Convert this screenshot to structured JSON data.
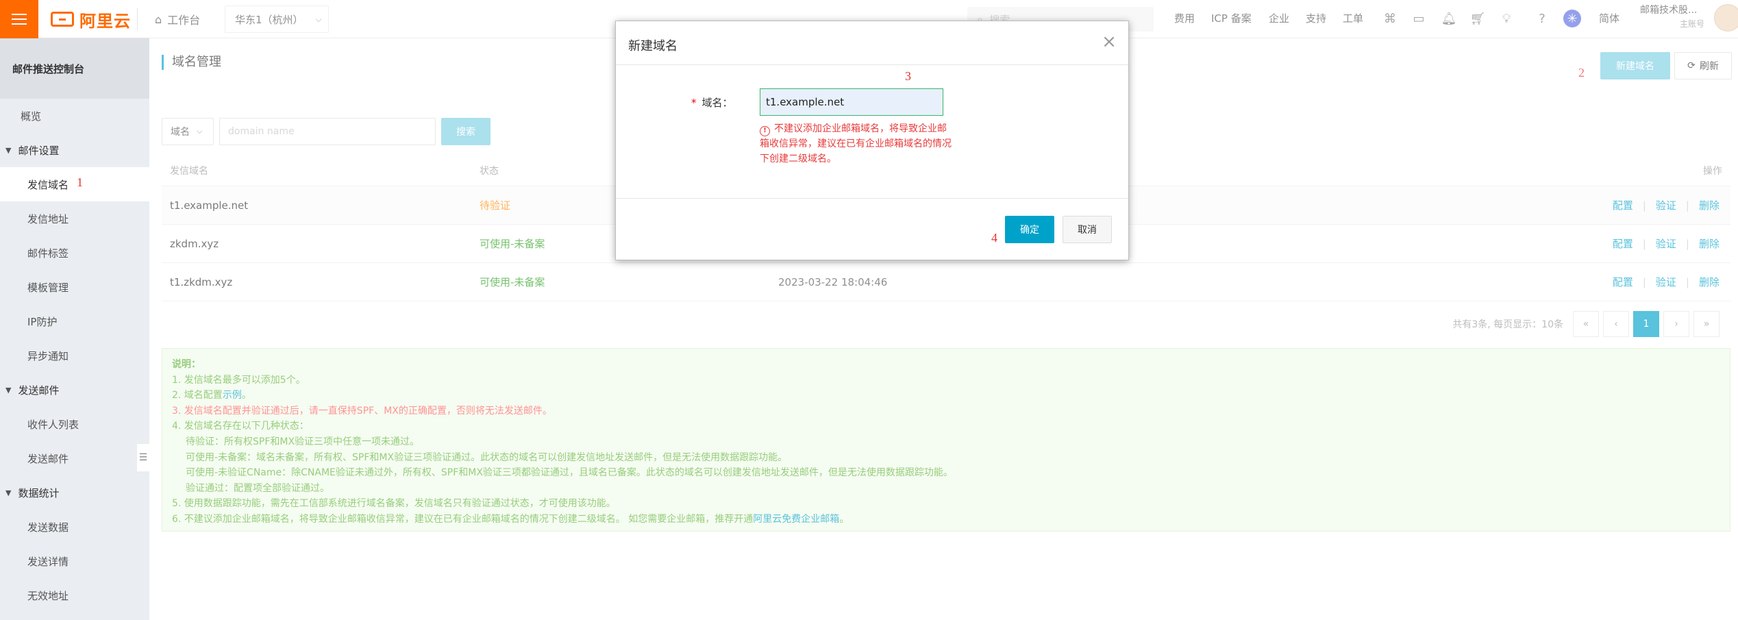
{
  "topbar": {
    "logo_text": "阿里云",
    "workbench": "工作台",
    "region": "华东1（杭州）",
    "search_placeholder": "搜索...",
    "nav": [
      "费用",
      "ICP 备案",
      "企业",
      "支持",
      "工单"
    ],
    "lang": "简体",
    "account_name": "邮箱技术股...",
    "account_role": "主账号"
  },
  "sidebar": {
    "title": "邮件推送控制台",
    "overview": "概览",
    "groups": [
      {
        "label": "邮件设置",
        "items": [
          "发信域名",
          "发信地址",
          "邮件标签",
          "模板管理",
          "IP防护",
          "异步通知"
        ]
      },
      {
        "label": "发送邮件",
        "items": [
          "收件人列表",
          "发送邮件"
        ]
      },
      {
        "label": "数据统计",
        "items": [
          "发送数据",
          "发送详情",
          "无效地址"
        ]
      }
    ]
  },
  "main": {
    "page_title": "域名管理",
    "new_domain_btn": "新建域名",
    "refresh_btn": "刷新",
    "filter_select": "域名",
    "filter_placeholder": "domain name",
    "search_btn": "搜索",
    "table": {
      "headers": {
        "domain": "发信域名",
        "status": "状态",
        "actions": "操作"
      },
      "rows": [
        {
          "domain": "t1.example.net",
          "status": "待验证",
          "time": ""
        },
        {
          "domain": "zkdm.xyz",
          "status": "可使用-未备案",
          "time": ""
        },
        {
          "domain": "t1.zkdm.xyz",
          "status": "可使用-未备案",
          "time": "2023-03-22 18:04:46"
        }
      ],
      "action_labels": [
        "配置",
        "验证",
        "删除"
      ]
    },
    "pagination": {
      "summary": "共有3条, 每页显示：10条",
      "first": "«",
      "prev": "‹",
      "current": "1",
      "next": "›",
      "last": "»"
    },
    "notes": {
      "title": "说明：",
      "l1": "1. 发信域名最多可以添加5个。",
      "l2_pre": "2. 域名配置",
      "l2_link": "示例",
      "l2_post": "。",
      "l3": "3. 发信域名配置并验证通过后，请一直保持SPF、MX的正确配置，否则将无法发送邮件。",
      "l4": "4. 发信域名存在以下几种状态：",
      "l4a": "待验证：所有权SPF和MX验证三项中任意一项未通过。",
      "l4b": "可使用-未备案：域名未备案，所有权、SPF和MX验证三项验证通过。此状态的域名可以创建发信地址发送邮件，但是无法使用数据跟踪功能。",
      "l4c": "可使用-未验证CName：除CNAME验证未通过外，所有权、SPF和MX验证三项都验证通过，且域名已备案。此状态的域名可以创建发信地址发送邮件，但是无法使用数据跟踪功能。",
      "l4d": "验证通过：配置项全部验证通过。",
      "l5": "5. 使用数据跟踪功能，需先在工信部系统进行域名备案，发信域名只有验证通过状态，才可使用该功能。",
      "l6_pre": "6. 不建议添加企业邮箱域名，将导致企业邮箱收信异常，建议在已有企业邮箱域名的情况下创建二级域名。 如您需要企业邮箱，推荐开通",
      "l6_link": "阿里云免费企业邮箱",
      "l6_post": "。"
    }
  },
  "modal": {
    "title": "新建域名",
    "field_label": "域名：",
    "required_mark": "*",
    "domain_value": "t1.example.net",
    "warning": "不建议添加企业邮箱域名，将导致企业邮箱收信异常，建议在已有企业邮箱域名的情况下创建二级域名。",
    "ok": "确定",
    "cancel": "取消"
  },
  "annotations": [
    "1",
    "2",
    "3",
    "4"
  ]
}
